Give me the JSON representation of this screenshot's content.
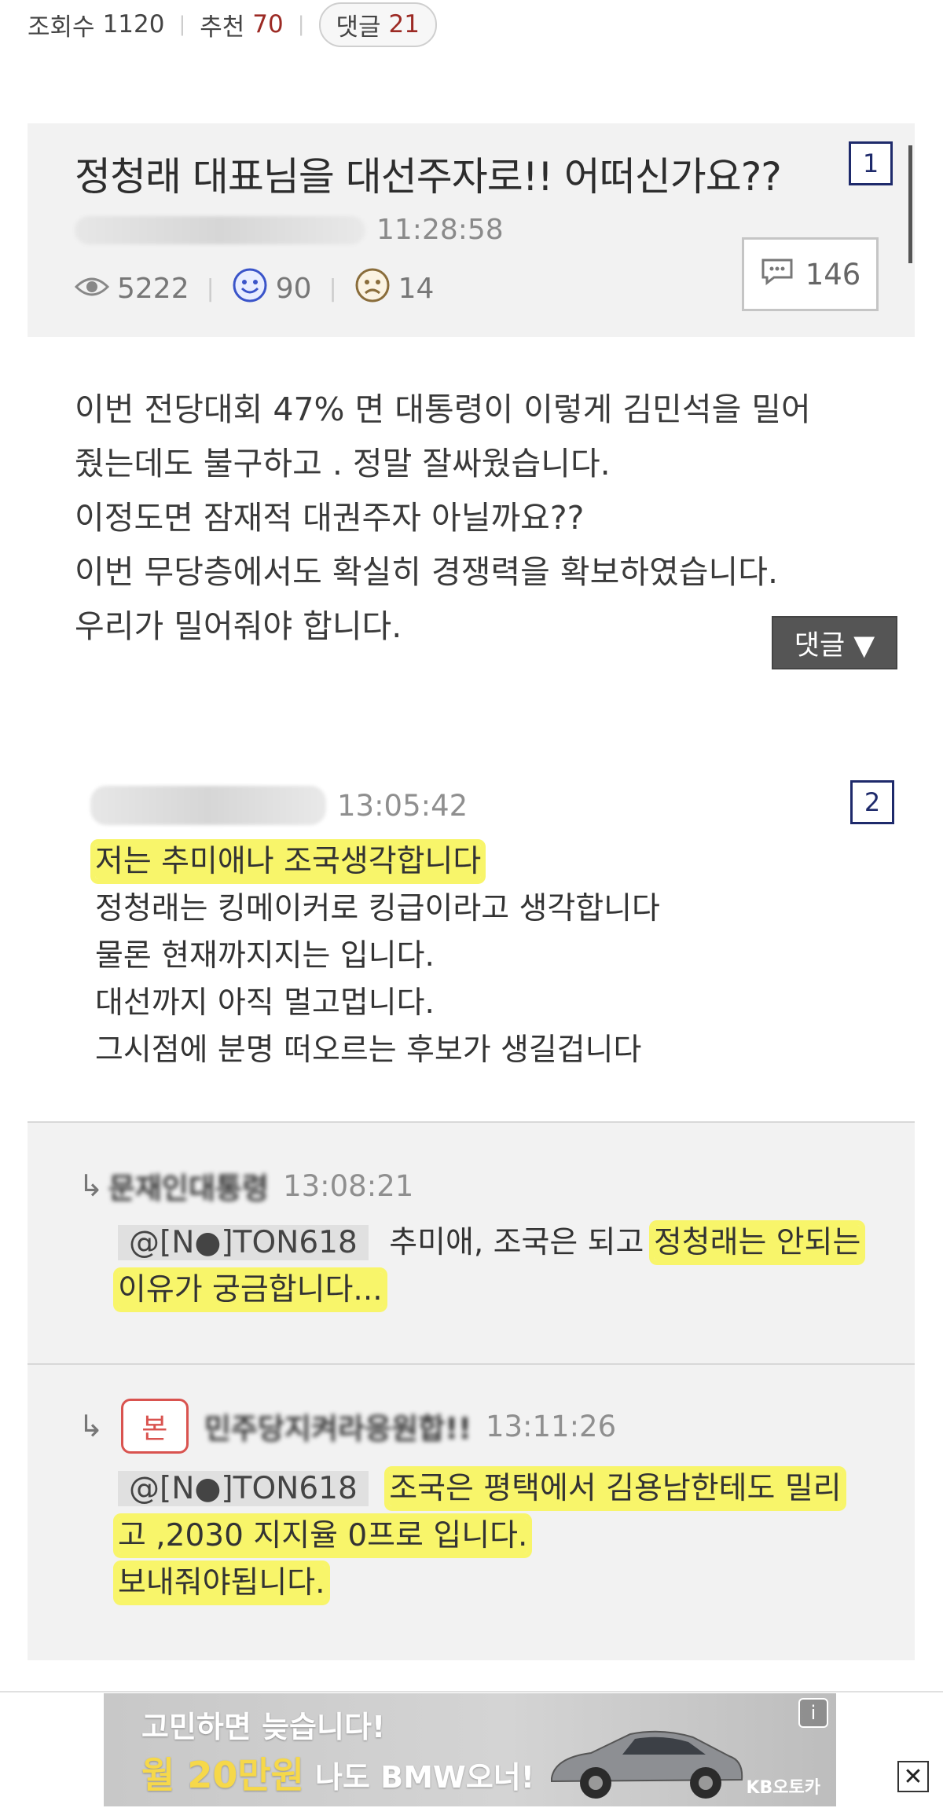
{
  "top_stats": {
    "views_label": "조회수",
    "views_value": "1120",
    "recommend_label": "추천",
    "recommend_value": "70",
    "comments_label": "댓글",
    "comments_value": "21"
  },
  "article": {
    "title": "정청래 대표님을 대선주자로!! 어떠신가요??",
    "marker": "1",
    "author": "민주당을지켜라!응원합!!",
    "time": "11:28:58",
    "views": "5222",
    "likes": "90",
    "dislikes": "14",
    "comment_count": "146",
    "body": [
      "이번 전당대회 47% 면 대통령이 이렇게 김민석을 밀어",
      "줬는데도 불구하고 . 정말 잘싸웠습니다.",
      "이정도면 잠재적 대권주자 아닐까요??",
      "이번 무당층에서도 확실히 경쟁력을 확보하였습니다.",
      "우리가 밀어줘야 합니다."
    ],
    "reply_button": "댓글 ▼"
  },
  "comments": [
    {
      "marker": "2",
      "time": "13:05:42",
      "highlight": "저는 추미애나 조국생각합니다",
      "lines": [
        "정청래는 킹메이커로 킹급이라고 생각합니다",
        "물론 현재까지지는 입니다.",
        "대선까지 아직 멀고멉니다.",
        "그시점에 분명 떠오르는 후보가 생길겁니다"
      ]
    }
  ],
  "replies": [
    {
      "author": "문재인대통령",
      "time": "13:08:21",
      "mention": "@[N●]TON618",
      "text_plain": "추미애, 조국은 되고 ",
      "text_hl": "정청래는 안되는",
      "line2": "이유가 궁금합니다..."
    },
    {
      "author": "민주당지켜라응원합!!",
      "time": "13:11:26",
      "stamp": "본",
      "mention": "@[N●]TON618",
      "text_hl": "조국은 평택에서 김용남한테도 밀리",
      "line2": "고 ,2030 지지율 0프로 입니다.",
      "line3": "보내줘야됩니다."
    }
  ],
  "ad": {
    "line1": "고민하면 늦습니다!",
    "line2": "월 20만원",
    "line2b": "나도 BMW오너!",
    "brand": "KB오토카",
    "info": "i",
    "close": "✕"
  },
  "icons": {
    "views": "eye-icon",
    "likes": "smile-icon",
    "dislikes": "frown-icon",
    "comments": "speech-bubble-icon",
    "reply": "reply-arrow-icon"
  }
}
